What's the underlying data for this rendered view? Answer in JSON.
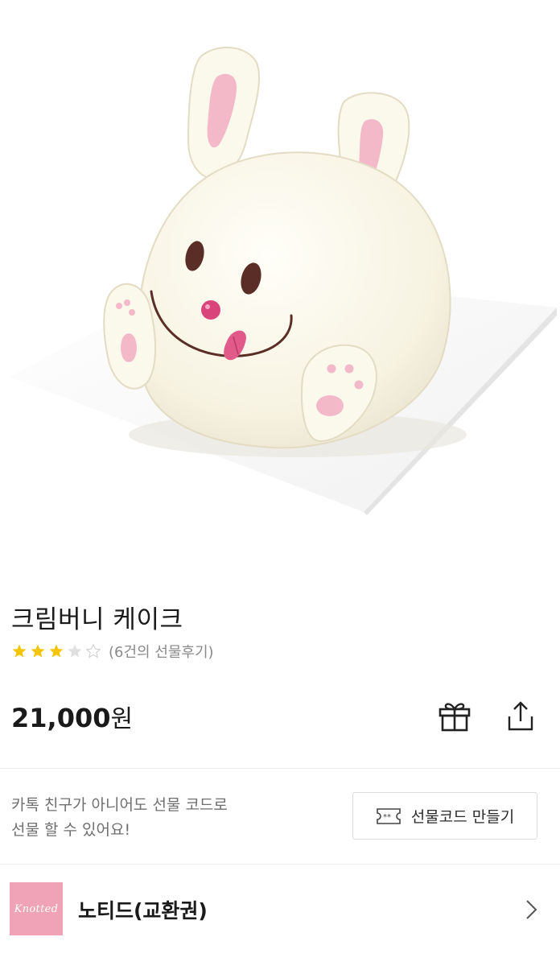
{
  "product": {
    "image_alt": "Cream bunny cake",
    "title": "크림버니 케이크",
    "rating": {
      "stars": 3,
      "max": 5,
      "text": "(6건의 선물후기)"
    },
    "price": {
      "amount": "21,000",
      "unit": "원"
    }
  },
  "actions": {
    "gift_icon": "gift-icon",
    "share_icon": "share-icon"
  },
  "promo": {
    "line1": "카톡 친구가 아니어도 선물 코드로",
    "line2": "선물 할 수 있어요!",
    "button_label": "선물코드 만들기",
    "button_icon": "ticket-icon"
  },
  "brand": {
    "logo_text": "Knotted",
    "name": "노티드(교환권)",
    "chevron": "chevron-right-icon"
  },
  "colors": {
    "star_filled": "#f5c500",
    "star_empty": "#d8d8d8",
    "brand_logo_bg": "#f0a3b6"
  }
}
